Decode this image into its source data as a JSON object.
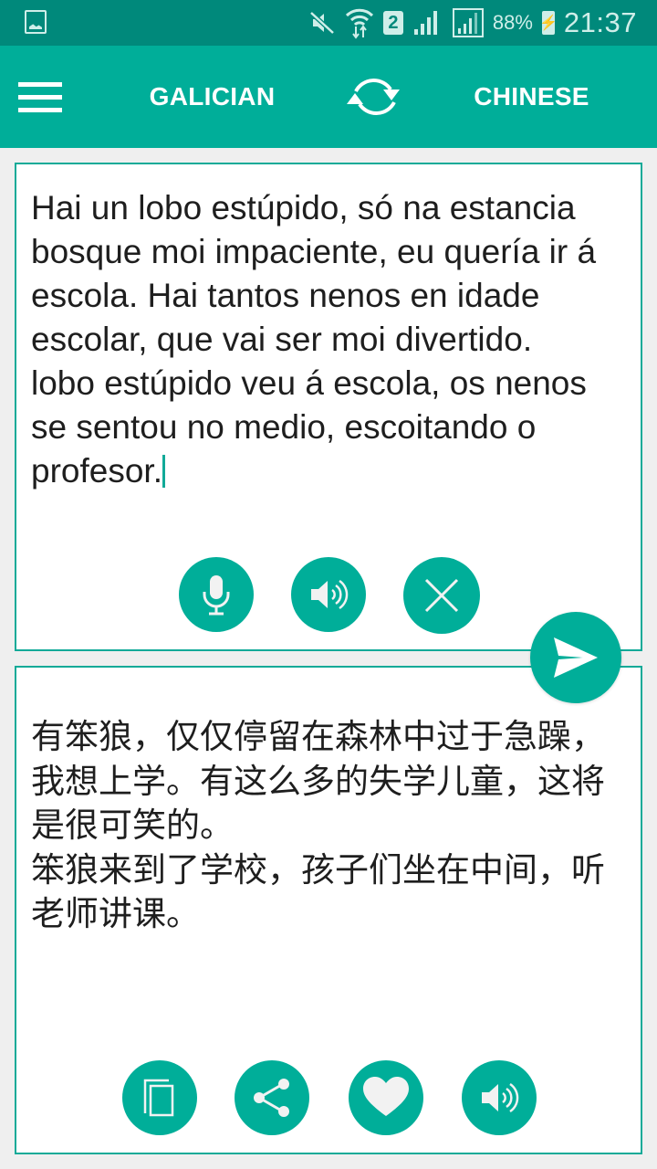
{
  "status_bar": {
    "left_icons": [
      "gallery-icon"
    ],
    "right_icons": [
      "mute-icon",
      "wifi-data-icon",
      "sim-2-icon",
      "signal-icon",
      "signal-icon-2",
      "battery-charging-icon"
    ],
    "sim_label": "2",
    "battery_percent": "88%",
    "time": "21:37"
  },
  "app_bar": {
    "menu_icon": "hamburger-menu-icon",
    "source_language": "GALICIAN",
    "swap_icon": "swap-arrows-icon",
    "target_language": "CHINESE",
    "color": "#00ae99"
  },
  "input_panel": {
    "text": "Hai un lobo estúpido, só na estancia bosque moi impaciente, eu quería ir á escola. Hai tantos nenos en idade escolar, que vai ser moi divertido.\nlobo estúpido veu á escola, os nenos se sentou no medio, escoitando o profesor.",
    "buttons": [
      {
        "name": "microphone",
        "icon": "microphone-icon"
      },
      {
        "name": "speak-source",
        "icon": "speaker-icon"
      },
      {
        "name": "clear",
        "icon": "close-icon"
      }
    ]
  },
  "translate_button": {
    "icon": "send-icon"
  },
  "output_panel": {
    "text": "有笨狼，仅仅停留在森林中过于急躁，我想上学。有这么多的失学儿童，这将是很可笑的。\n笨狼来到了学校，孩子们坐在中间，听老师讲课。",
    "buttons": [
      {
        "name": "copy",
        "icon": "copy-icon"
      },
      {
        "name": "share",
        "icon": "share-icon"
      },
      {
        "name": "favorite",
        "icon": "heart-icon"
      },
      {
        "name": "speak-translation",
        "icon": "speaker-icon"
      }
    ]
  },
  "colors": {
    "status_bar": "#00897b",
    "accent": "#00ae99",
    "panel_border": "#11aa98",
    "background": "#efefef"
  }
}
